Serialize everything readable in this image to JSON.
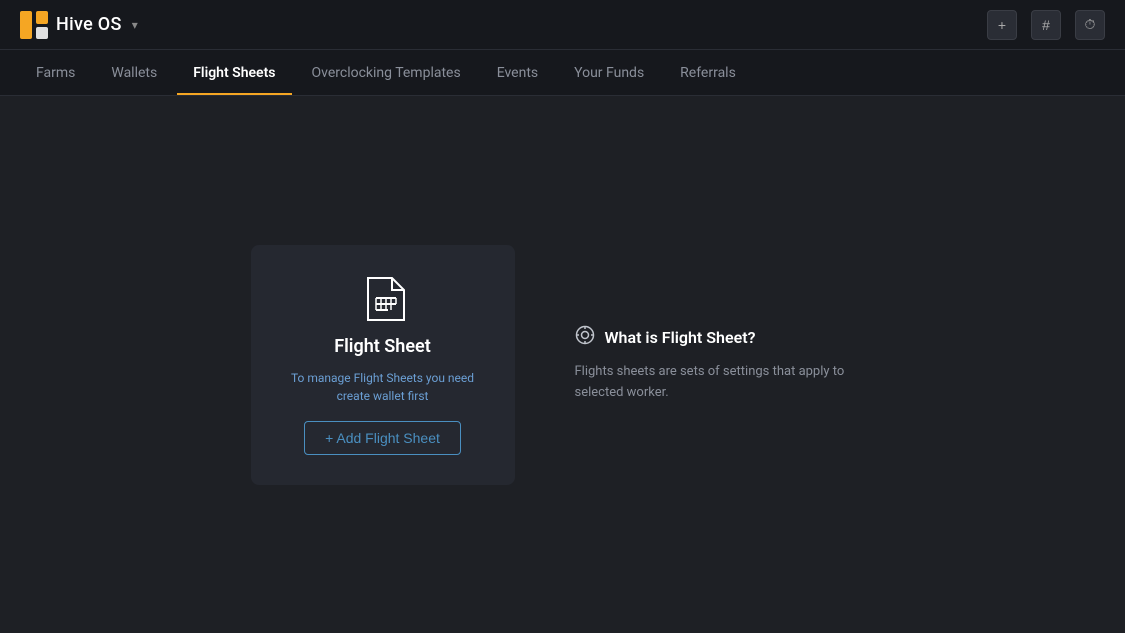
{
  "header": {
    "brand": "Hive OS",
    "dropdown_symbol": "▾",
    "icons": {
      "plus": "+",
      "hash": "#",
      "clock": "⏱"
    }
  },
  "nav": {
    "items": [
      {
        "label": "Farms",
        "active": false
      },
      {
        "label": "Wallets",
        "active": false
      },
      {
        "label": "Flight Sheets",
        "active": true
      },
      {
        "label": "Overclocking Templates",
        "active": false
      },
      {
        "label": "Events",
        "active": false
      },
      {
        "label": "Your Funds",
        "active": false
      },
      {
        "label": "Referrals",
        "active": false
      }
    ]
  },
  "card": {
    "title": "Flight Sheet",
    "subtitle": "To manage Flight Sheets you need create wallet first",
    "add_button": "+ Add Flight Sheet"
  },
  "info": {
    "icon": "⊙",
    "title": "What is Flight Sheet?",
    "description": "Flights sheets are sets of settings that apply to selected worker."
  },
  "colors": {
    "background": "#1e2025",
    "header_bg": "#16181d",
    "card_bg": "#252830",
    "accent_orange": "#f5a623",
    "accent_blue": "#4a8fc0",
    "text_primary": "#ffffff",
    "text_secondary": "#8a8f9a",
    "text_blue": "#6b9fd4"
  }
}
